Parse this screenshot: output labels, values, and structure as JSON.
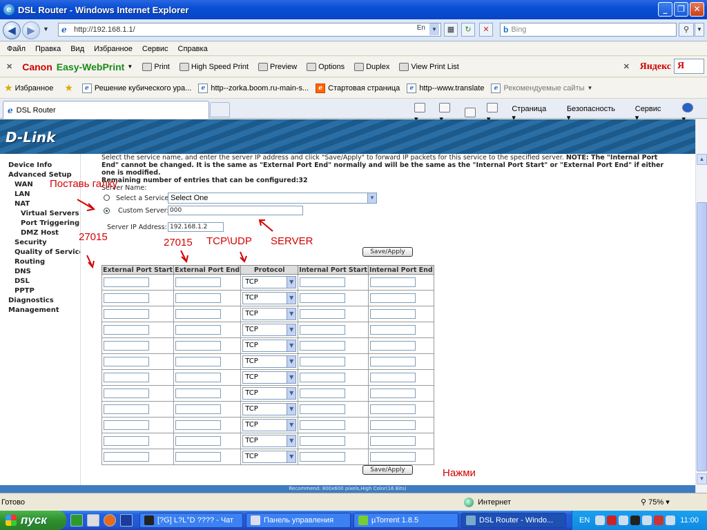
{
  "window": {
    "title": "DSL Router - Windows Internet Explorer",
    "min": "_",
    "max": "❐",
    "close": "✕"
  },
  "address": {
    "url": "http://192.168.1.1/",
    "lang_badge": "En",
    "search_placeholder": "Bing",
    "search_icon": "magnifier-icon"
  },
  "menu": [
    "Файл",
    "Правка",
    "Вид",
    "Избранное",
    "Сервис",
    "Справка"
  ],
  "canon_toolbar": {
    "brand": "Canon",
    "product": "Easy-WebPrint",
    "items": [
      "Print",
      "High Speed Print",
      "Preview",
      "Options",
      "Duplex",
      "View Print List"
    ],
    "yandex": "Яндекс",
    "yandex_input": "Я"
  },
  "favorites": {
    "label": "Избранное",
    "items": [
      "Решение кубического ура...",
      "http--zorka.boom.ru-main-s...",
      "Стартовая страница",
      "http--www.translate",
      "Рекомендуемые сайты"
    ]
  },
  "tab": {
    "label": "DSL Router",
    "tools": [
      "Страница",
      "Безопасность",
      "Сервис"
    ]
  },
  "router": {
    "logo": "D-Link",
    "sidebar": [
      "Device Info",
      "Advanced Setup",
      "WAN",
      "LAN",
      "NAT",
      "Virtual Servers",
      "Port Triggering",
      "DMZ Host",
      "Security",
      "Quality of Service",
      "Routing",
      "DNS",
      "DSL",
      "PPTP",
      "Diagnostics",
      "Management"
    ],
    "description_1": "Select the service name, and enter the server IP address and click \"Save/Apply\" to forward IP packets for this service to the specified server.",
    "description_note": "NOTE: The \"Internal Port End\" cannot be changed. It is the same as \"External Port End\" normally and will be the same as the \"Internal Port Start\" or \"External Port End\" if either one is modified.",
    "description_remaining": "Remaining number of entries that can be configured:32",
    "server_name_label": "Server Name:",
    "select_service_label": "Select a Service:",
    "select_service_value": "Select One",
    "custom_server_label": "Custom Server:",
    "custom_server_value": "000",
    "server_ip_label": "Server IP Address:",
    "server_ip_value": "192.168.1.2",
    "save_apply": "Save/Apply",
    "columns": [
      "External Port Start",
      "External Port End",
      "Protocol",
      "Internal Port Start",
      "Internal Port End"
    ],
    "protocol_default": "TCP",
    "rows": 12,
    "recommend": "Recommend: 800x600 pixels,High Color(16 Bits)"
  },
  "annotations": {
    "put_check": "Поставь галку",
    "port_1": "27015",
    "port_2": "27015",
    "protocol": "TCP\\UDP",
    "server": "SERVER",
    "press": "Нажми"
  },
  "status": {
    "ready": "Готово",
    "zone": "Интернет",
    "zoom": "75%"
  },
  "taskbar": {
    "start": "пуск",
    "tasks": [
      "[?G]  L?L°D  ???? - Чат",
      "Панель управления",
      "µTorrent 1.8.5",
      "DSL Router - Windo..."
    ],
    "lang": "EN",
    "clock": "11:00"
  }
}
